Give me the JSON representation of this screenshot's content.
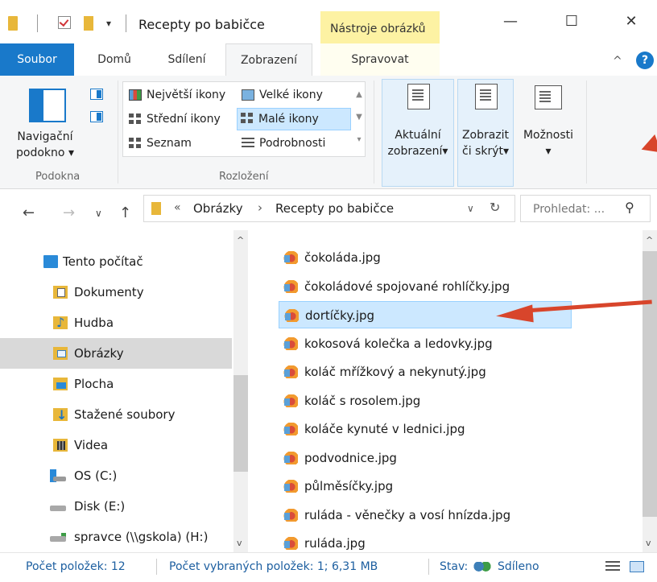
{
  "window": {
    "title": "Recepty po babičce",
    "context_tab": "Nástroje obrázků"
  },
  "tabs": {
    "file": "Soubor",
    "home": "Domů",
    "share": "Sdílení",
    "view": "Zobrazení",
    "manage": "Spravovat"
  },
  "ribbon": {
    "nav_pane_line1": "Navigační",
    "nav_pane_line2": "podokno",
    "group_panes": "Podokna",
    "group_layout": "Rozložení",
    "layout": {
      "extra_large": "Největší ikony",
      "large": "Velké ikony",
      "medium": "Střední ikony",
      "small": "Malé ikony",
      "list": "Seznam",
      "details": "Podrobnosti"
    },
    "current_view_line1": "Aktuální",
    "current_view_line2": "zobrazení",
    "show_hide_line1": "Zobrazit",
    "show_hide_line2": "či skrýt",
    "options": "Možnosti"
  },
  "address": {
    "prefix": "«",
    "crumb1": "Obrázky",
    "separator": "›",
    "crumb2": "Recepty po babičce",
    "search_placeholder": "Prohledat: ..."
  },
  "nav": {
    "this_pc": "Tento počítač",
    "documents": "Dokumenty",
    "music": "Hudba",
    "pictures": "Obrázky",
    "desktop": "Plocha",
    "downloads": "Stažené soubory",
    "videos": "Videa",
    "os": "OS (C:)",
    "disk": "Disk (E:)",
    "network": "spravce (\\\\gskola) (H:)"
  },
  "files": [
    "čokoláda.jpg",
    "čokoládové spojované rohlíčky.jpg",
    "dortíčky.jpg",
    "kokosová kolečka a ledovky.jpg",
    "koláč mřížkový a nekynutý.jpg",
    "koláč s rosolem.jpg",
    "koláče kynuté v lednici.jpg",
    "podvodnice.jpg",
    "půlměsíčky.jpg",
    "ruláda - věnečky a vosí hnízda.jpg",
    "ruláda.jpg"
  ],
  "status": {
    "count": "Počet položek: 12",
    "selected": "Počet vybraných položek: 1; 6,31 MB",
    "state_label": "Stav:",
    "state_value": "Sdíleno"
  },
  "colors": {
    "accent": "#1979ca",
    "selection": "#cce8ff",
    "annotation_arrow": "#d8452b"
  }
}
